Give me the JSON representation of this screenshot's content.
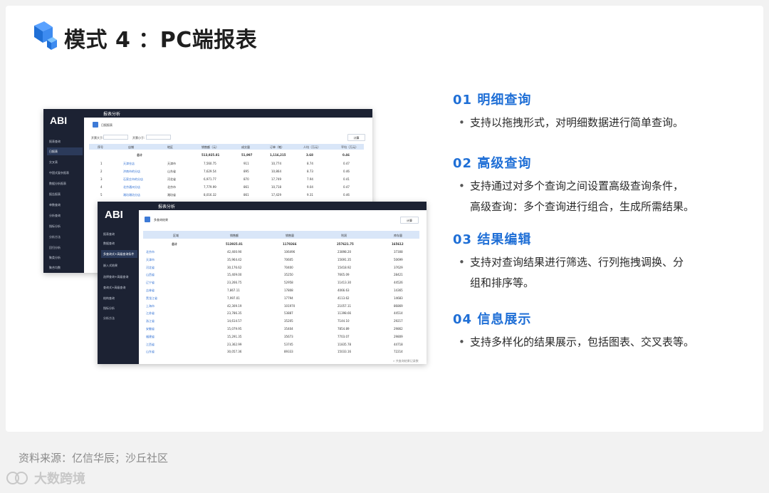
{
  "page_title": "模式 4 ：PC端报表",
  "features": [
    {
      "heading": "01  明细查询",
      "lines": [
        "支持以拖拽形式，对明细数据进行简单查询。"
      ]
    },
    {
      "heading": "02  高级查询",
      "lines": [
        "支持通过对多个查询之间设置高级查询条件，",
        "高级查询：多个查询进行组合，生成所需结果。"
      ]
    },
    {
      "heading": "03  结果编辑",
      "lines": [
        "支持对查询结果进行筛选、行列拖拽调换、分",
        "组和排序等。"
      ]
    },
    {
      "heading": "04  信息展示",
      "lines": [
        "支持多样化的结果展示，包括图表、交叉表等。"
      ]
    }
  ],
  "source": "资料来源：亿信华辰；沙丘社区",
  "watermark": "大数跨境",
  "colors": {
    "accent": "#1f6fd6",
    "sidebar": "#1c2233",
    "header_row": "#d9e6f8"
  },
  "back_shot": {
    "logo": "ABI",
    "topbar_title": "报表分析",
    "tab": "日报报表",
    "filter1": "开票大于:",
    "filter2": "开票小于:",
    "button": "计算",
    "sidebar": [
      "报表查询",
      "日报表",
      "交叉表",
      "中国式复杂报表",
      "数据分析报表",
      "报告报表",
      "单数查询",
      "分析查询",
      "指标分析",
      "分析方法",
      "回归分析",
      "聚类分析",
      "聚合均数"
    ],
    "columns": [
      "序号",
      "店铺",
      "地区",
      "销售额（元）",
      "成交量",
      "订单（笔）",
      "人均（万元）",
      "平均（万元）"
    ],
    "total": {
      "label": "总计",
      "sales": "513,925.81",
      "qty": "51,997",
      "orders": "1,116,215",
      "avg": "3.68",
      "mean": "0.46"
    },
    "rows": [
      {
        "n": "1",
        "shop": "天津仓店",
        "area": "天津市",
        "sales": "7,560.75",
        "qty": "911",
        "orders": "10,774",
        "avg": "8.74",
        "mean": "0.47"
      },
      {
        "n": "2",
        "shop": "济南市的分店",
        "area": "山东省",
        "sales": "7,629.54",
        "qty": "895",
        "orders": "10,864",
        "avg": "8.73",
        "mean": "0.46"
      },
      {
        "n": "3",
        "shop": "石家庄市的分店",
        "area": "河北省",
        "sales": "6,971.77",
        "qty": "870",
        "orders": "17,749",
        "avg": "7.94",
        "mean": "0.41"
      },
      {
        "n": "4",
        "shop": "北京通州分店",
        "area": "北京市",
        "sales": "7,779.99",
        "qty": "861",
        "orders": "10,718",
        "avg": "9.04",
        "mean": "0.47"
      },
      {
        "n": "5",
        "shop": "潍坊潍坊分店",
        "area": "潍坊省",
        "sales": "8,016.32",
        "qty": "861",
        "orders": "17,429",
        "avg": "9.31",
        "mean": "0.46"
      }
    ]
  },
  "front_shot": {
    "logo": "ABI",
    "topbar_title": "报表分析",
    "tab": "多查询结果",
    "button": "计算",
    "footer_note": "» 共查询结果记录数",
    "sidebar": [
      "报表查询",
      "数据查询",
      "多查询式+高级查询条件",
      "嵌入式结果",
      "选择查询+高级查询",
      "查询式+高级查询",
      "结构查询",
      "指标分析",
      "分析方法"
    ],
    "columns": [
      "区域",
      "销售额",
      "销售量",
      "利润",
      "库存量"
    ],
    "total": {
      "label": "总计",
      "sales": "513925.81",
      "qty": "1170266",
      "profit": "257621.75",
      "stock": "165612"
    },
    "rows": [
      {
        "region": "北京市",
        "sales": "42,400.90",
        "qty": "106496",
        "profit": "23898.20",
        "stock": "37308"
      },
      {
        "region": "天津市",
        "sales": "35,964.42",
        "qty": "70605",
        "profit": "15691.35",
        "stock": "50699"
      },
      {
        "region": "河北省",
        "sales": "30,176.62",
        "qty": "70400",
        "profit": "15418.92",
        "stock": "37629"
      },
      {
        "region": "山西省",
        "sales": "15,409.00",
        "qty": "35250",
        "profit": "7665.09",
        "stock": "28421"
      },
      {
        "region": "辽宁省",
        "sales": "23,266.75",
        "qty": "52958",
        "profit": "11413.30",
        "stock": "44526"
      },
      {
        "region": "吉林省",
        "sales": "7,867.11",
        "qty": "17808",
        "profit": "4066.63",
        "stock": "14365"
      },
      {
        "region": "黑龙江省",
        "sales": "7,997.01",
        "qty": "17794",
        "profit": "4113.62",
        "stock": "14683"
      },
      {
        "region": "上海市",
        "sales": "42,309.19",
        "qty": "101970",
        "profit": "21057.11",
        "stock": "86869"
      },
      {
        "region": "江苏省",
        "sales": "23,786.35",
        "qty": "53887",
        "profit": "11398.66",
        "stock": "44514"
      },
      {
        "region": "浙江省",
        "sales": "14,614.57",
        "qty": "35205",
        "profit": "7144.10",
        "stock": "29217"
      },
      {
        "region": "安徽省",
        "sales": "15,079.95",
        "qty": "35404",
        "profit": "7854.89",
        "stock": "29862"
      },
      {
        "region": "福建省",
        "sales": "15,291.35",
        "qty": "35673",
        "profit": "7703.07",
        "stock": "29809"
      },
      {
        "region": "江西省",
        "sales": "23,362.99",
        "qty": "53745",
        "profit": "11835.78",
        "stock": "44718"
      },
      {
        "region": "山东省",
        "sales": "30,057.36",
        "qty": "89333",
        "profit": "15033.16",
        "stock": "72214"
      }
    ]
  }
}
